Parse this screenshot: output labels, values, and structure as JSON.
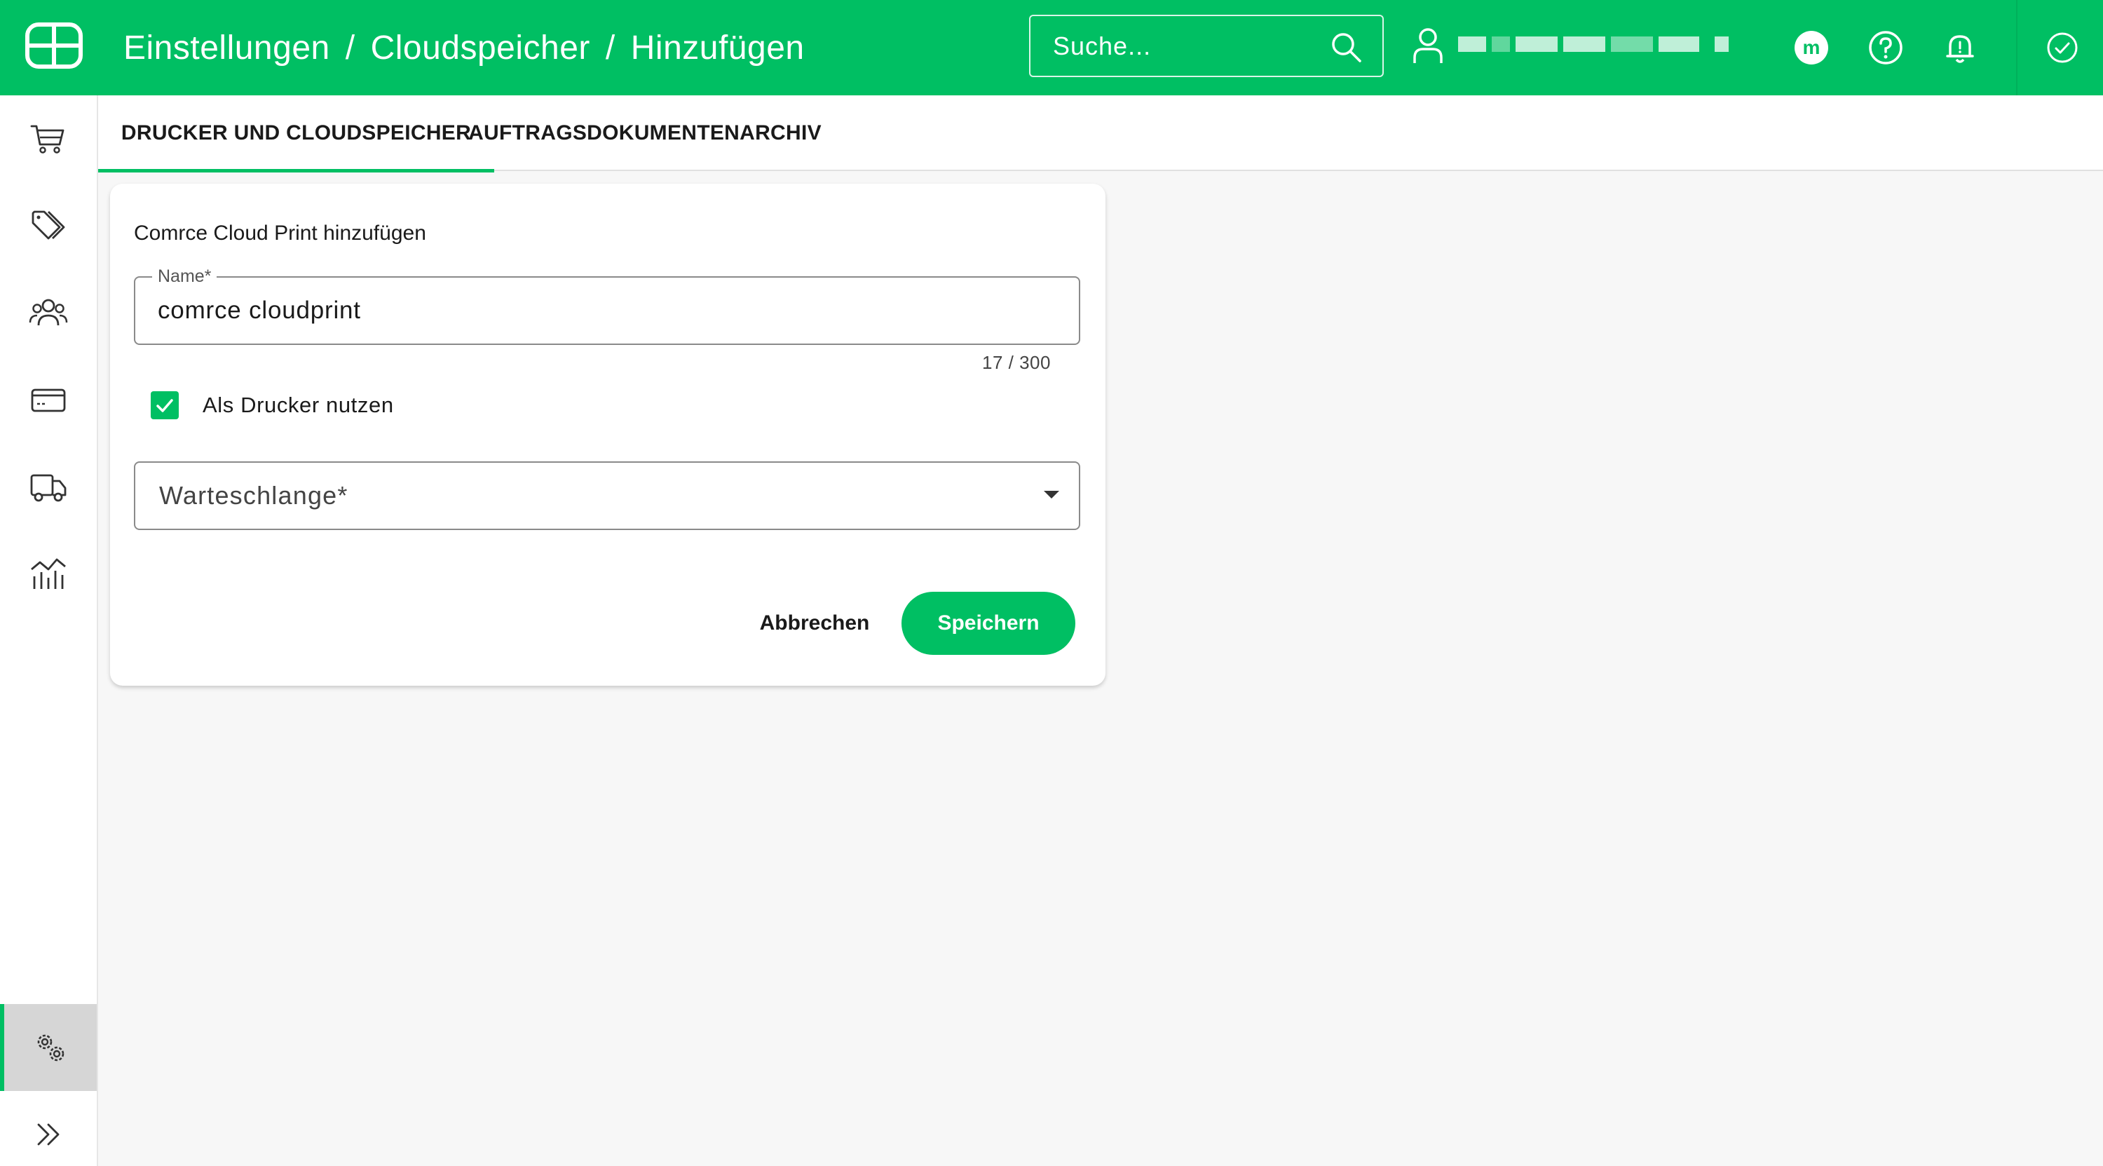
{
  "header": {
    "breadcrumb": [
      "Einstellungen",
      "Cloudspeicher",
      "Hinzufügen"
    ],
    "separator": "/",
    "search_placeholder": "Suche...",
    "brand_color": "#00bf63",
    "icons": [
      "logo-icon",
      "search-icon",
      "user-icon",
      "marketplace-icon",
      "help-icon",
      "notification-bell-icon",
      "check-circle-icon"
    ]
  },
  "sidebar": {
    "items": [
      {
        "name": "sidebar-item-orders",
        "icon": "cart-icon"
      },
      {
        "name": "sidebar-item-products",
        "icon": "tags-icon"
      },
      {
        "name": "sidebar-item-customers",
        "icon": "users-icon"
      },
      {
        "name": "sidebar-item-payments",
        "icon": "credit-card-icon"
      },
      {
        "name": "sidebar-item-shipping",
        "icon": "truck-icon"
      },
      {
        "name": "sidebar-item-analytics",
        "icon": "chart-icon"
      },
      {
        "name": "sidebar-item-settings",
        "icon": "gears-icon",
        "active": true
      },
      {
        "name": "sidebar-expand",
        "icon": "chevrons-right-icon"
      }
    ]
  },
  "tabs": [
    {
      "label": "DRUCKER UND CLOUDSPEICHER",
      "active": true
    },
    {
      "label": "AUFTRAGSDOKUMENTENARCHIV",
      "active": false
    }
  ],
  "form": {
    "title": "Comrce Cloud Print hinzufügen",
    "name_label": "Name*",
    "name_value": "comrce cloudprint",
    "name_counter": "17 / 300",
    "printer_checkbox_label": "Als Drucker nutzen",
    "printer_checkbox_checked": true,
    "queue_label": "Warteschlange*",
    "cancel_label": "Abbrechen",
    "save_label": "Speichern"
  }
}
